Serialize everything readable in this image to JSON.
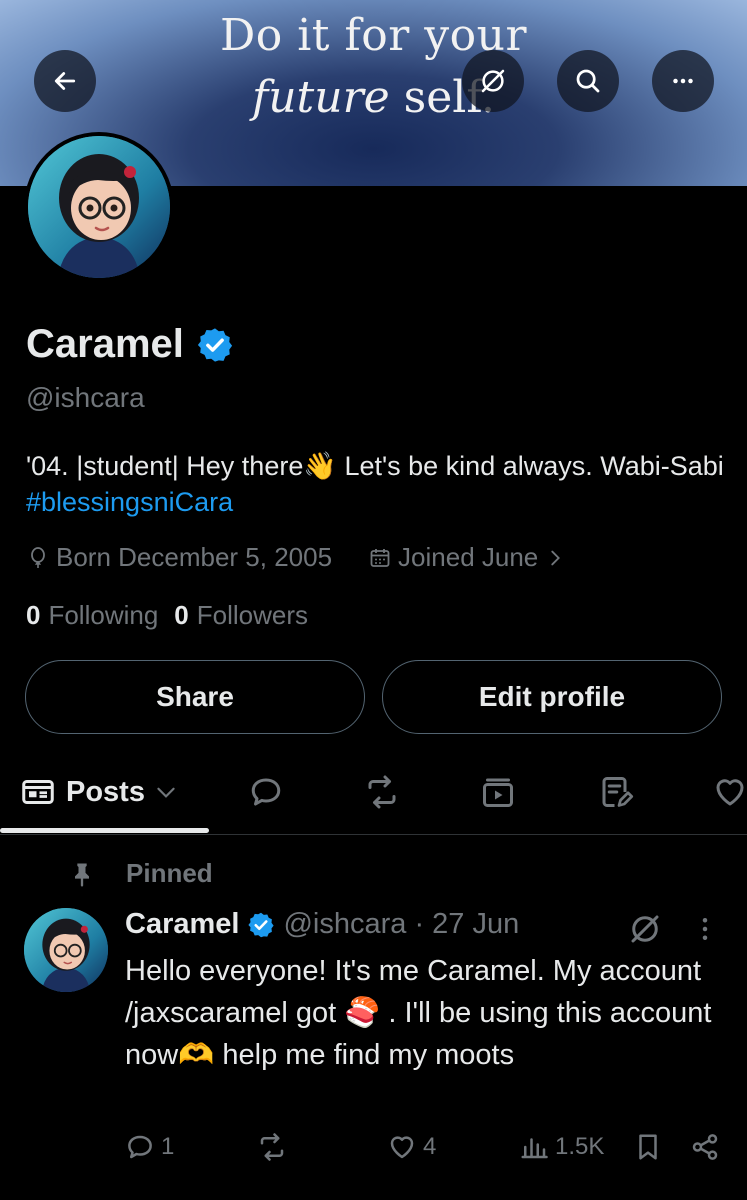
{
  "banner": {
    "line1": "Do it for your",
    "line2_italic": "future",
    "line2_rest": " self."
  },
  "profile": {
    "name": "Caramel",
    "handle": "@ishcara",
    "bio_text": "'04. |student| Hey there👋 Let's be kind always. Wabi-Sabi ",
    "bio_hashtag": "#blessingsniCara",
    "born": "Born December 5, 2005",
    "joined": "Joined June",
    "following_count": "0",
    "following_label": "Following",
    "followers_count": "0",
    "followers_label": "Followers"
  },
  "buttons": {
    "share": "Share",
    "edit_profile": "Edit profile"
  },
  "tabs": {
    "posts": "Posts"
  },
  "post": {
    "pinned_label": "Pinned",
    "author": "Caramel",
    "handle_time": "@ishcara · 27 Jun",
    "text": "Hello everyone! It's me Caramel. My account /jaxscaramel got 🍣 . I'll be using this account now🫶 help me find my moots",
    "replies": "1",
    "likes": "4",
    "views": "1.5K"
  },
  "colors": {
    "accent": "#1d9bf0",
    "muted": "#71767b",
    "border": "#2f3336"
  }
}
